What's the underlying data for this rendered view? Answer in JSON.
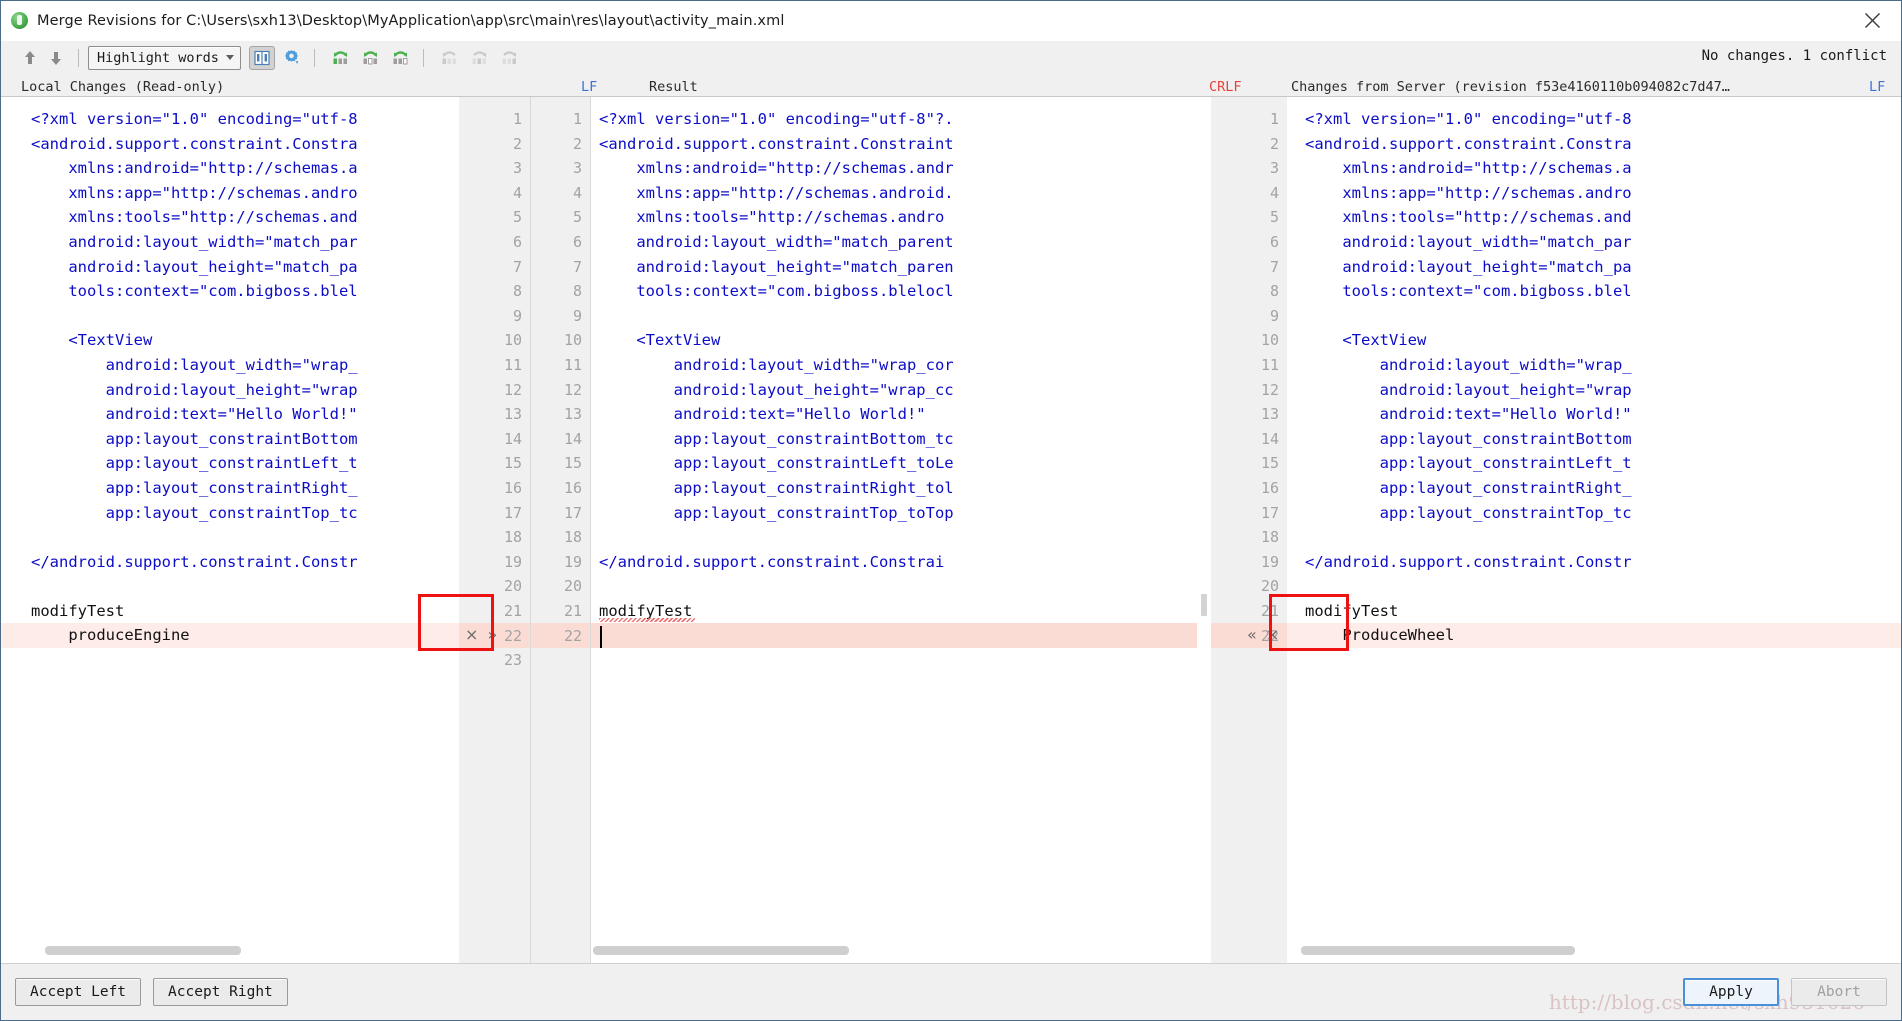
{
  "window": {
    "title": "Merge Revisions for C:\\Users\\sxh13\\Desktop\\MyApplication\\app\\src\\main\\res\\layout\\activity_main.xml",
    "app_icon": "android-studio-icon",
    "close_icon": "close-icon"
  },
  "toolbar": {
    "prev_icon": "arrow-up-icon",
    "next_icon": "arrow-down-icon",
    "highlight_mode": "Highlight words",
    "highlight_caret": "chevron-down-icon",
    "whitespace_icon": "side-by-side-view-icon",
    "settings_icon": "gear-icon",
    "collapse_icons": [
      "collapse-all-icon",
      "expand-all-icon",
      "collapse-unchanged-icon"
    ],
    "merge_icons": [
      "apply-left-icon",
      "apply-both-icon",
      "apply-right-icon"
    ],
    "status": "No changes. 1 conflict"
  },
  "headers": {
    "left": "Local Changes (Read-only)",
    "left_sep": "LF",
    "result": "Result",
    "result_sep": "CRLF",
    "right": "Changes from Server (revision f53e4160110b094082c7d47…",
    "right_sep": "LF"
  },
  "left_pane": {
    "line_numbers": [
      "1",
      "2",
      "3",
      "4",
      "5",
      "6",
      "7",
      "8",
      "9",
      "10",
      "11",
      "12",
      "13",
      "14",
      "15",
      "16",
      "17",
      "18",
      "19",
      "20",
      "21",
      "22",
      "23"
    ],
    "conflict_marks": "× »",
    "conflict_line": "22",
    "code": [
      "<?xml version=\"1.0\" encoding=\"utf-8",
      "<android.support.constraint.Constra",
      "    xmlns:android=\"http://schemas.a",
      "    xmlns:app=\"http://schemas.andro",
      "    xmlns:tools=\"http://schemas.and",
      "    android:layout_width=\"match_par",
      "    android:layout_height=\"match_pa",
      "    tools:context=\"com.bigboss.blel",
      "",
      "    <TextView",
      "        android:layout_width=\"wrap_",
      "        android:layout_height=\"wrap",
      "        android:text=\"Hello World!\"",
      "        app:layout_constraintBottom",
      "        app:layout_constraintLeft_t",
      "        app:layout_constraintRight_",
      "        app:layout_constraintTop_tc",
      "",
      "</android.support.constraint.Constr",
      "",
      "modifyTest",
      "    produceEngine",
      ""
    ]
  },
  "center_pane": {
    "line_numbers": [
      "1",
      "2",
      "3",
      "4",
      "5",
      "6",
      "7",
      "8",
      "9",
      "10",
      "11",
      "12",
      "13",
      "14",
      "15",
      "16",
      "17",
      "18",
      "19",
      "20",
      "21",
      "22"
    ],
    "code": [
      "<?xml version=\"1.0\" encoding=\"utf-8\"?.",
      "<android.support.constraint.Constraint",
      "    xmlns:android=\"http://schemas.andr",
      "    xmlns:app=\"http://schemas.android.",
      "    xmlns:tools=\"http://schemas.andro",
      "    android:layout_width=\"match_parent",
      "    android:layout_height=\"match_paren",
      "    tools:context=\"com.bigboss.blelocl",
      "",
      "    <TextView",
      "        android:layout_width=\"wrap_cor",
      "        android:layout_height=\"wrap_cc",
      "        android:text=\"Hello World!\"",
      "        app:layout_constraintBottom_tc",
      "        app:layout_constraintLeft_toLe",
      "        app:layout_constraintRight_tol",
      "        app:layout_constraintTop_toTop",
      "",
      "</android.support.constraint.Constrai",
      "",
      "modifyTest",
      ""
    ]
  },
  "right_pane": {
    "line_numbers": [
      "1",
      "2",
      "3",
      "4",
      "5",
      "6",
      "7",
      "8",
      "9",
      "10",
      "11",
      "12",
      "13",
      "14",
      "15",
      "16",
      "17",
      "18",
      "19",
      "20",
      "21",
      "22"
    ],
    "conflict_marks": "« ×",
    "conflict_line": "22",
    "code": [
      "<?xml version=\"1.0\" encoding=\"utf-8",
      "<android.support.constraint.Constra",
      "    xmlns:android=\"http://schemas.a",
      "    xmlns:app=\"http://schemas.andro",
      "    xmlns:tools=\"http://schemas.and",
      "    android:layout_width=\"match_par",
      "    android:layout_height=\"match_pa",
      "    tools:context=\"com.bigboss.blel",
      "",
      "    <TextView",
      "        android:layout_width=\"wrap_",
      "        android:layout_height=\"wrap",
      "        android:text=\"Hello World!\"",
      "        app:layout_constraintBottom",
      "        app:layout_constraintLeft_t",
      "        app:layout_constraintRight_",
      "        app:layout_constraintTop_tc",
      "",
      "</android.support.constraint.Constr",
      "",
      "modifyTest",
      "    ProduceWheel"
    ]
  },
  "bottom": {
    "accept_left": "Accept Left",
    "accept_right": "Accept Right",
    "apply": "Apply",
    "abort": "Abort"
  },
  "watermark": "http://blog.csdn.net/sxh951026",
  "colors": {
    "conflict_band": "#fbdcd5",
    "annotation": "#ee1111",
    "code_blue": "#0c0cc8",
    "header_blue": "#3f72d8",
    "header_red": "#e8413a",
    "accent": "#4a90d9"
  }
}
